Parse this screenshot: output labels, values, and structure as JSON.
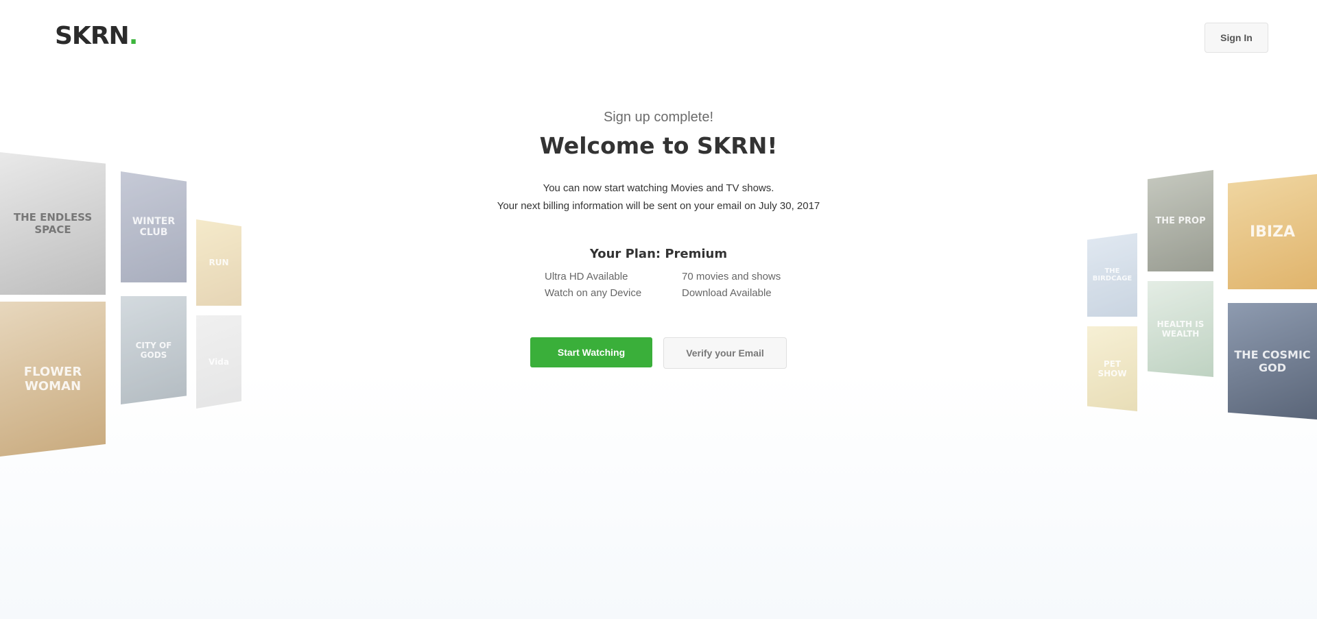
{
  "header": {
    "logo_text": "SKRN",
    "logo_dot": ".",
    "signin_label": "Sign In"
  },
  "main": {
    "subtitle": "Sign up complete!",
    "title": "Welcome to SKRN!",
    "message_line1": "You can now start watching Movies and TV shows.",
    "message_line2": "Your next billing information will be sent on your email on July 30, 2017",
    "plan_label": "Your Plan: Premium",
    "features": [
      "Ultra HD Available",
      "70 movies and shows",
      "Watch on any Device",
      "Download Available"
    ],
    "start_label": "Start Watching",
    "verify_label": "Verify your Email"
  },
  "posters": {
    "left": [
      "THE ENDLESS SPACE",
      "WINTER CLUB",
      "RUN",
      "FLOWER WOMAN",
      "CITY OF GODS",
      "Vida"
    ],
    "right": [
      "THE PROP",
      "IBIZA",
      "THE BIRDCAGE",
      "HEALTH IS WEALTH",
      "PET SHOW",
      "THE COSMIC GOD"
    ]
  },
  "colors": {
    "accent": "#3aaf3a",
    "text": "#333333"
  }
}
